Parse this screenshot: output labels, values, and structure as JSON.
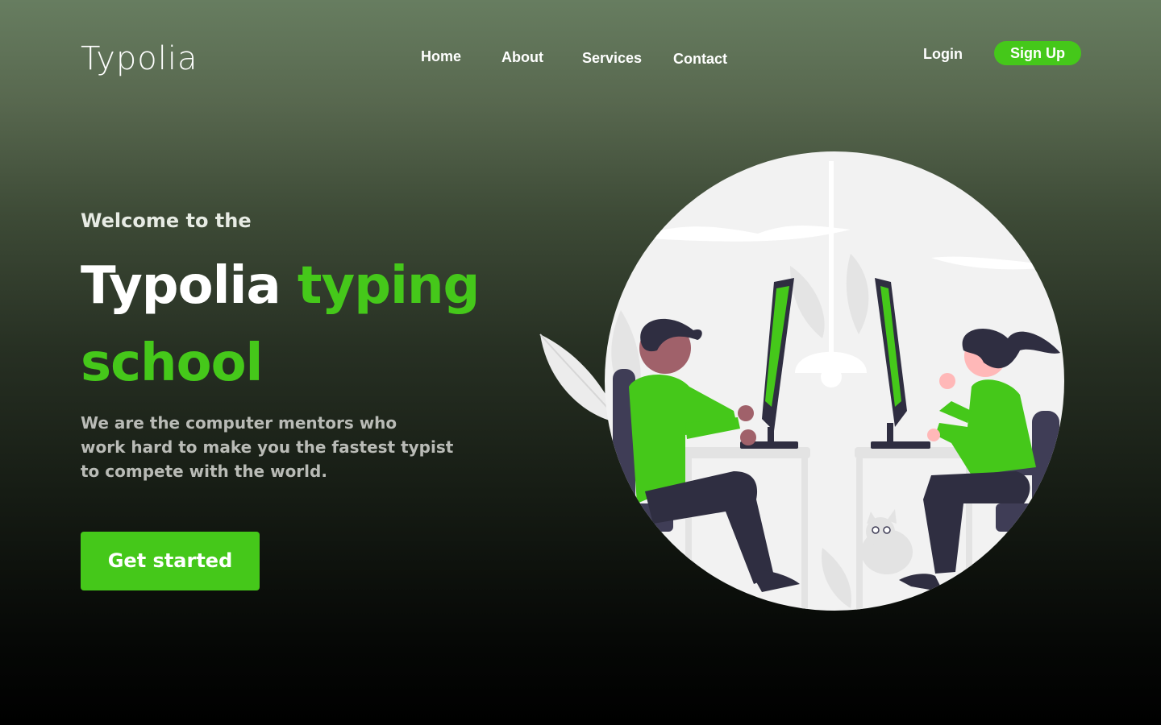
{
  "brand": {
    "logo": "Typolia"
  },
  "nav": {
    "items": [
      {
        "label": "Home"
      },
      {
        "label": "About"
      },
      {
        "label": "Services"
      },
      {
        "label": "Contact"
      }
    ],
    "login_label": "Login",
    "signup_label": "Sign Up"
  },
  "hero": {
    "welcome": "Welcome to the",
    "headline_white": "Typolia",
    "headline_green_1": "typing",
    "headline_green_2": "school",
    "subtitle_lines": [
      "We are the computer mentors who",
      "work hard to make you the fastest typist",
      "to compete with the world."
    ],
    "cta_label": "Get started"
  },
  "colors": {
    "accent": "#45c81a",
    "text": "#ffffff",
    "muted_text": "#b9bbb6",
    "illustration_bg": "#f2f2f2",
    "illustration_dark": "#2f2e41"
  },
  "icons": {
    "hero_image": "people-typing-at-computers-illustration"
  }
}
